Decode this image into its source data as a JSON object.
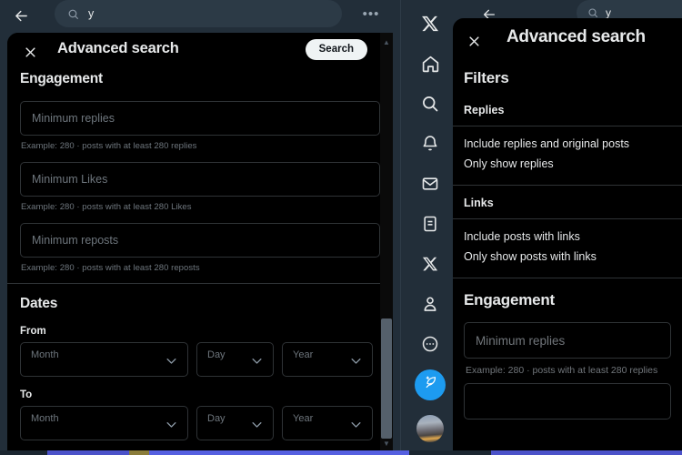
{
  "left_window": {
    "topbar": {
      "back_icon": "back-arrow-icon",
      "search_icon": "search-icon",
      "search_value": "y",
      "more_icon": "more-horizontal-icon",
      "more_label": "•••"
    },
    "modal": {
      "close_icon": "close-icon",
      "title": "Advanced search",
      "search_button": "Search",
      "engagement": {
        "heading": "Engagement",
        "fields": [
          {
            "placeholder": "Minimum replies",
            "hint": "Example: 280 · posts with at least 280 replies"
          },
          {
            "placeholder": "Minimum Likes",
            "hint": "Example: 280 · posts with at least 280 Likes"
          },
          {
            "placeholder": "Minimum reposts",
            "hint": "Example: 280 · posts with at least 280 reposts"
          }
        ]
      },
      "dates": {
        "heading": "Dates",
        "from_label": "From",
        "to_label": "To",
        "month_placeholder": "Month",
        "day_placeholder": "Day",
        "year_placeholder": "Year",
        "chevron_icon": "chevron-down-icon"
      }
    },
    "scrollbar": {
      "up_arrow_icon": "scroll-up-arrow-icon",
      "down_arrow_icon": "scroll-down-arrow-icon"
    }
  },
  "right_window": {
    "sidebar": {
      "items": [
        {
          "name": "x-logo",
          "label": "X"
        },
        {
          "name": "home-icon",
          "label": "Home"
        },
        {
          "name": "search-icon",
          "label": "Explore"
        },
        {
          "name": "bell-icon",
          "label": "Notifications"
        },
        {
          "name": "envelope-icon",
          "label": "Messages"
        },
        {
          "name": "list-icon",
          "label": "Lists"
        },
        {
          "name": "x-premium-icon",
          "label": "Premium"
        },
        {
          "name": "person-icon",
          "label": "Profile"
        },
        {
          "name": "more-circle-icon",
          "label": "More"
        }
      ],
      "post_button": {
        "icon": "post-feather-icon",
        "label": "Post"
      },
      "avatar": "profile-avatar"
    },
    "topbar": {
      "back_icon": "back-arrow-icon",
      "search_icon": "search-icon",
      "search_value": "y"
    },
    "modal": {
      "close_icon": "close-icon",
      "title": "Advanced search",
      "filters_heading": "Filters",
      "groups": [
        {
          "title": "Replies",
          "options": [
            "Include replies and original posts",
            "Only show replies"
          ]
        },
        {
          "title": "Links",
          "options": [
            "Include posts with links",
            "Only show posts with links"
          ]
        }
      ],
      "engagement": {
        "heading": "Engagement",
        "field_placeholder": "Minimum replies",
        "field_hint": "Example: 280 · posts with at least 280 replies"
      }
    }
  },
  "colors": {
    "app_background": "#222e39",
    "modal_background": "#000000",
    "border": "#2f3336",
    "placeholder": "#6e767d",
    "text": "#e7e9ea",
    "accent_blue": "#1d9bf0",
    "button_white": "#eff3f4"
  }
}
